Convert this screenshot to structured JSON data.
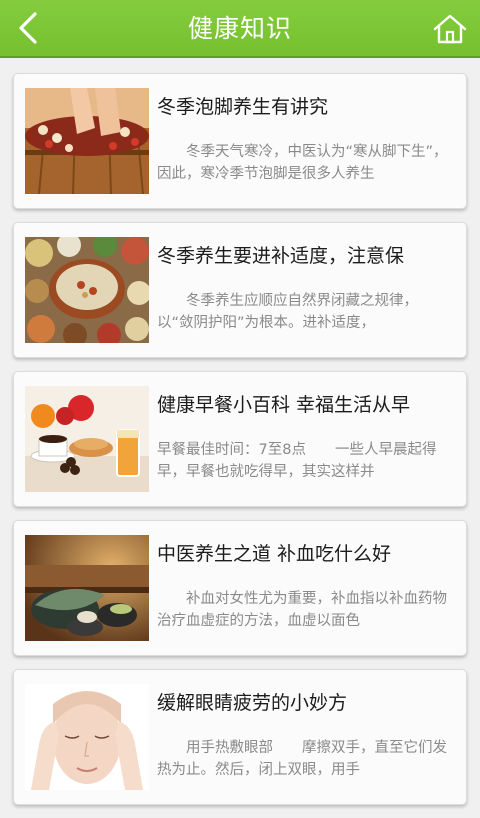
{
  "header": {
    "title": "健康知识",
    "back_icon": "back-arrow-icon",
    "home_icon": "home-icon",
    "bar_color": "#7bc435"
  },
  "articles": [
    {
      "title": "冬季泡脚养生有讲究",
      "summary": "　　冬季天气寒冷，中医认为“寒从脚下生”，因此，寒冷季节泡脚是很多人养生",
      "image": "foot-bath-photo"
    },
    {
      "title": "冬季养生要进补适度，注意保",
      "summary": "　　冬季养生应顺应自然界闭藏之规律，以“敛阴护阳”为根本。进补适度，",
      "image": "herbal-soup-photo"
    },
    {
      "title": "健康早餐小百科 幸福生活从早",
      "summary": "早餐最佳时间：7至8点　　一些人早晨起得早，早餐也就吃得早，其实这样并",
      "image": "breakfast-photo"
    },
    {
      "title": "中医养生之道 补血吃什么好",
      "summary": "　　补血对女性尤为重要，补血指以补血药物治疗血虚症的方法，血虚以面色",
      "image": "spa-stones-photo"
    },
    {
      "title": "缓解眼睛疲劳的小妙方",
      "summary": "　　用手热敷眼部　　摩擦双手，直至它们发热为止。然后，闭上双眼，用手",
      "image": "face-massage-photo"
    }
  ]
}
